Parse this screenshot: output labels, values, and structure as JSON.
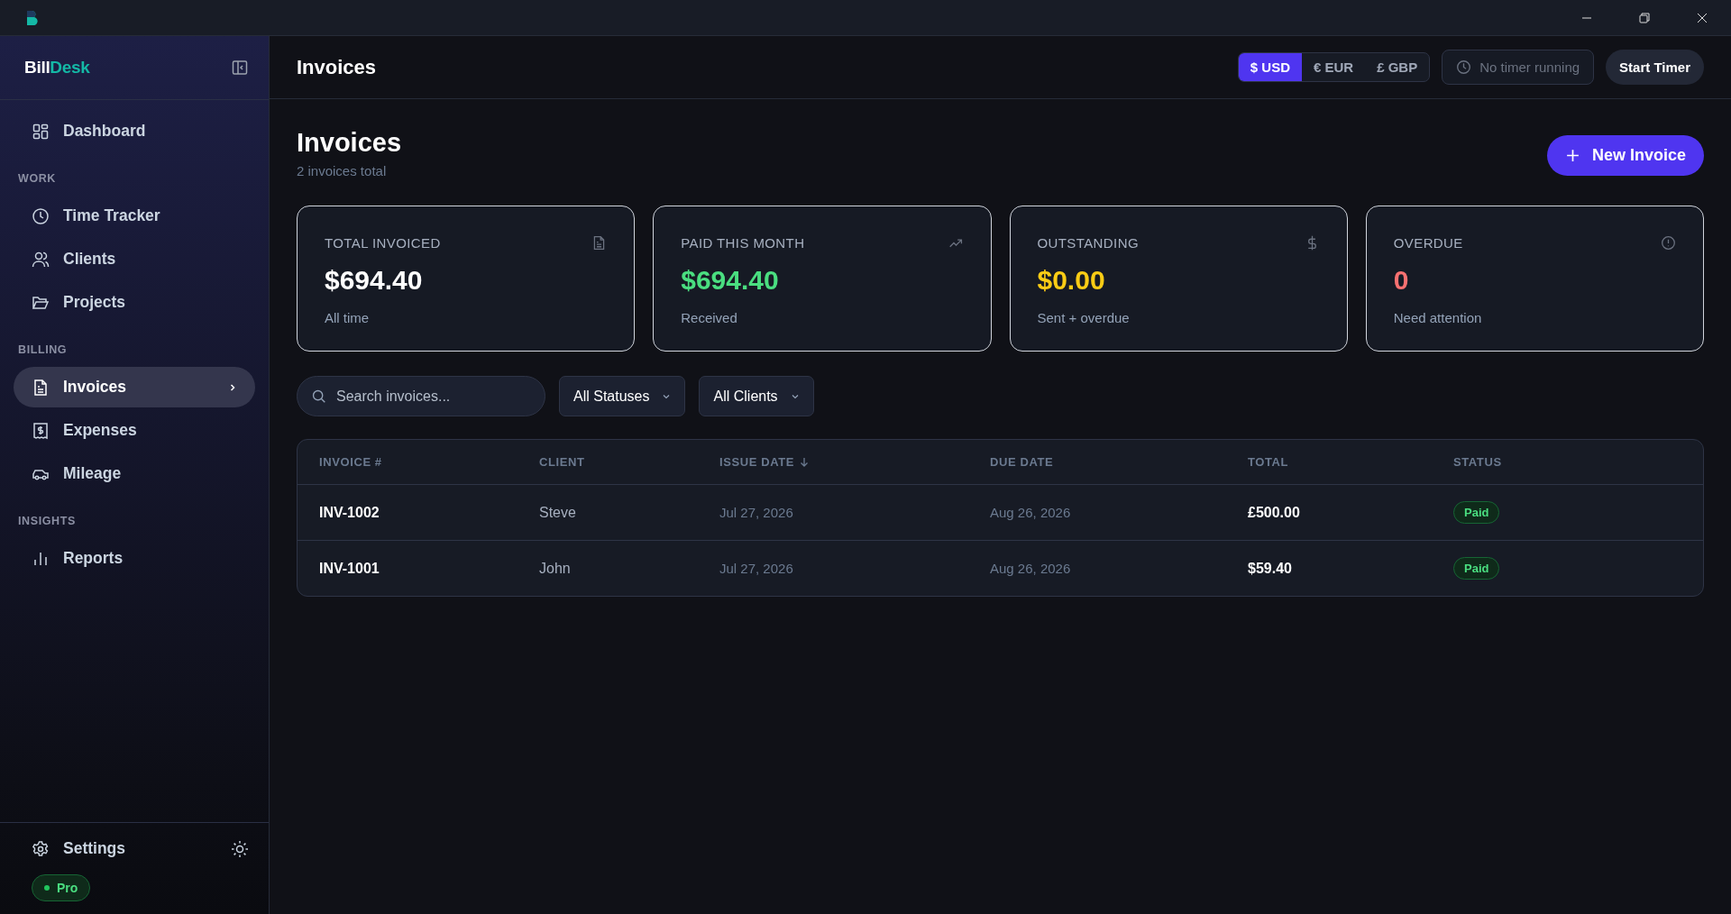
{
  "brand": {
    "part_1": "Bill",
    "part_2": "Desk"
  },
  "nav": [
    {
      "kind": "link",
      "label": "Dashboard",
      "selected": false
    },
    {
      "kind": "heading",
      "label": "WORK"
    },
    {
      "kind": "link",
      "label": "Time Tracker",
      "selected": false
    },
    {
      "kind": "link",
      "label": "Clients",
      "selected": false
    },
    {
      "kind": "link",
      "label": "Projects",
      "selected": false
    },
    {
      "kind": "heading",
      "label": "BILLING"
    },
    {
      "kind": "link",
      "label": "Invoices",
      "selected": true
    },
    {
      "kind": "link",
      "label": "Expenses",
      "selected": false
    },
    {
      "kind": "link",
      "label": "Mileage",
      "selected": false
    },
    {
      "kind": "heading",
      "label": "INSIGHTS"
    },
    {
      "kind": "link",
      "label": "Reports",
      "selected": false
    }
  ],
  "sidebar_footer": {
    "settings": "Settings",
    "plan": "Pro"
  },
  "header": {
    "title": "Invoices",
    "currencies": [
      {
        "label": "$ USD",
        "selected": true
      },
      {
        "label": "€ EUR",
        "selected": false
      },
      {
        "label": "£ GBP",
        "selected": false
      }
    ],
    "timer": "No timer running",
    "start_button": "Start Timer"
  },
  "page": {
    "title": "Invoices",
    "subtitle": "2 invoices total",
    "new_button": "New Invoice"
  },
  "stats": [
    {
      "label": "TOTAL INVOICED",
      "value": "$694.40",
      "note": "All time",
      "color": "#ffffff"
    },
    {
      "label": "PAID THIS MONTH",
      "value": "$694.40",
      "note": "Received",
      "color": "#4ade80"
    },
    {
      "label": "OUTSTANDING",
      "value": "$0.00",
      "note": "Sent + overdue",
      "color": "#facc15"
    },
    {
      "label": "OVERDUE",
      "value": "0",
      "note": "Need attention",
      "color": "#f87171"
    }
  ],
  "filters": {
    "search": {
      "placeholder": "Search invoices..."
    },
    "status": "All Statuses",
    "client": "All Clients"
  },
  "table": {
    "columns": [
      {
        "label": "INVOICE #",
        "sorted": false
      },
      {
        "label": "CLIENT",
        "sorted": false
      },
      {
        "label": "ISSUE DATE",
        "sorted": true
      },
      {
        "label": "DUE DATE",
        "sorted": false
      },
      {
        "label": "TOTAL",
        "sorted": false
      },
      {
        "label": "STATUS",
        "sorted": false
      }
    ],
    "rows": [
      {
        "number": "INV-1002",
        "client": "Steve",
        "issue_date": "Jul 27, 2026",
        "due_date": "Aug 26, 2026",
        "total": "£500.00",
        "status": "Paid"
      },
      {
        "number": "INV-1001",
        "client": "John",
        "issue_date": "Jul 27, 2026",
        "due_date": "Aug 26, 2026",
        "total": "$59.40",
        "status": "Paid"
      }
    ]
  }
}
